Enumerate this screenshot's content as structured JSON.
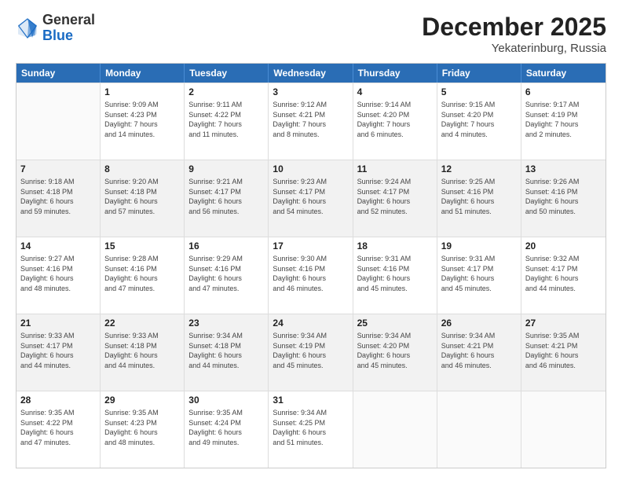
{
  "header": {
    "logo_general": "General",
    "logo_blue": "Blue",
    "month": "December 2025",
    "location": "Yekaterinburg, Russia"
  },
  "days_of_week": [
    "Sunday",
    "Monday",
    "Tuesday",
    "Wednesday",
    "Thursday",
    "Friday",
    "Saturday"
  ],
  "weeks": [
    [
      {
        "day": "",
        "info": ""
      },
      {
        "day": "1",
        "info": "Sunrise: 9:09 AM\nSunset: 4:23 PM\nDaylight: 7 hours\nand 14 minutes."
      },
      {
        "day": "2",
        "info": "Sunrise: 9:11 AM\nSunset: 4:22 PM\nDaylight: 7 hours\nand 11 minutes."
      },
      {
        "day": "3",
        "info": "Sunrise: 9:12 AM\nSunset: 4:21 PM\nDaylight: 7 hours\nand 8 minutes."
      },
      {
        "day": "4",
        "info": "Sunrise: 9:14 AM\nSunset: 4:20 PM\nDaylight: 7 hours\nand 6 minutes."
      },
      {
        "day": "5",
        "info": "Sunrise: 9:15 AM\nSunset: 4:20 PM\nDaylight: 7 hours\nand 4 minutes."
      },
      {
        "day": "6",
        "info": "Sunrise: 9:17 AM\nSunset: 4:19 PM\nDaylight: 7 hours\nand 2 minutes."
      }
    ],
    [
      {
        "day": "7",
        "info": "Sunrise: 9:18 AM\nSunset: 4:18 PM\nDaylight: 6 hours\nand 59 minutes."
      },
      {
        "day": "8",
        "info": "Sunrise: 9:20 AM\nSunset: 4:18 PM\nDaylight: 6 hours\nand 57 minutes."
      },
      {
        "day": "9",
        "info": "Sunrise: 9:21 AM\nSunset: 4:17 PM\nDaylight: 6 hours\nand 56 minutes."
      },
      {
        "day": "10",
        "info": "Sunrise: 9:23 AM\nSunset: 4:17 PM\nDaylight: 6 hours\nand 54 minutes."
      },
      {
        "day": "11",
        "info": "Sunrise: 9:24 AM\nSunset: 4:17 PM\nDaylight: 6 hours\nand 52 minutes."
      },
      {
        "day": "12",
        "info": "Sunrise: 9:25 AM\nSunset: 4:16 PM\nDaylight: 6 hours\nand 51 minutes."
      },
      {
        "day": "13",
        "info": "Sunrise: 9:26 AM\nSunset: 4:16 PM\nDaylight: 6 hours\nand 50 minutes."
      }
    ],
    [
      {
        "day": "14",
        "info": "Sunrise: 9:27 AM\nSunset: 4:16 PM\nDaylight: 6 hours\nand 48 minutes."
      },
      {
        "day": "15",
        "info": "Sunrise: 9:28 AM\nSunset: 4:16 PM\nDaylight: 6 hours\nand 47 minutes."
      },
      {
        "day": "16",
        "info": "Sunrise: 9:29 AM\nSunset: 4:16 PM\nDaylight: 6 hours\nand 47 minutes."
      },
      {
        "day": "17",
        "info": "Sunrise: 9:30 AM\nSunset: 4:16 PM\nDaylight: 6 hours\nand 46 minutes."
      },
      {
        "day": "18",
        "info": "Sunrise: 9:31 AM\nSunset: 4:16 PM\nDaylight: 6 hours\nand 45 minutes."
      },
      {
        "day": "19",
        "info": "Sunrise: 9:31 AM\nSunset: 4:17 PM\nDaylight: 6 hours\nand 45 minutes."
      },
      {
        "day": "20",
        "info": "Sunrise: 9:32 AM\nSunset: 4:17 PM\nDaylight: 6 hours\nand 44 minutes."
      }
    ],
    [
      {
        "day": "21",
        "info": "Sunrise: 9:33 AM\nSunset: 4:17 PM\nDaylight: 6 hours\nand 44 minutes."
      },
      {
        "day": "22",
        "info": "Sunrise: 9:33 AM\nSunset: 4:18 PM\nDaylight: 6 hours\nand 44 minutes."
      },
      {
        "day": "23",
        "info": "Sunrise: 9:34 AM\nSunset: 4:18 PM\nDaylight: 6 hours\nand 44 minutes."
      },
      {
        "day": "24",
        "info": "Sunrise: 9:34 AM\nSunset: 4:19 PM\nDaylight: 6 hours\nand 45 minutes."
      },
      {
        "day": "25",
        "info": "Sunrise: 9:34 AM\nSunset: 4:20 PM\nDaylight: 6 hours\nand 45 minutes."
      },
      {
        "day": "26",
        "info": "Sunrise: 9:34 AM\nSunset: 4:21 PM\nDaylight: 6 hours\nand 46 minutes."
      },
      {
        "day": "27",
        "info": "Sunrise: 9:35 AM\nSunset: 4:21 PM\nDaylight: 6 hours\nand 46 minutes."
      }
    ],
    [
      {
        "day": "28",
        "info": "Sunrise: 9:35 AM\nSunset: 4:22 PM\nDaylight: 6 hours\nand 47 minutes."
      },
      {
        "day": "29",
        "info": "Sunrise: 9:35 AM\nSunset: 4:23 PM\nDaylight: 6 hours\nand 48 minutes."
      },
      {
        "day": "30",
        "info": "Sunrise: 9:35 AM\nSunset: 4:24 PM\nDaylight: 6 hours\nand 49 minutes."
      },
      {
        "day": "31",
        "info": "Sunrise: 9:34 AM\nSunset: 4:25 PM\nDaylight: 6 hours\nand 51 minutes."
      },
      {
        "day": "",
        "info": ""
      },
      {
        "day": "",
        "info": ""
      },
      {
        "day": "",
        "info": ""
      }
    ]
  ]
}
